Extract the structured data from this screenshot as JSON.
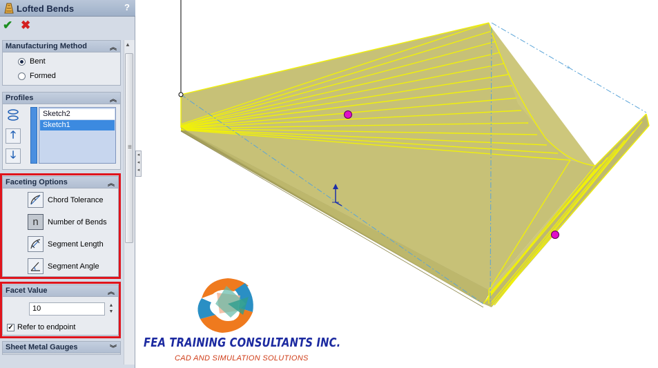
{
  "window": {
    "feature_title": "Lofted Bends",
    "help_glyph": "?",
    "ok_glyph": "✔",
    "cancel_glyph": "✖"
  },
  "manufacturing_method": {
    "title": "Manufacturing Method",
    "options": [
      {
        "label": "Bent",
        "selected": true
      },
      {
        "label": "Formed",
        "selected": false
      }
    ]
  },
  "profiles": {
    "title": "Profiles",
    "items": [
      {
        "label": "Sketch2",
        "selected": false
      },
      {
        "label": "Sketch1",
        "selected": true
      }
    ]
  },
  "faceting_options": {
    "title": "Faceting Options",
    "options": [
      {
        "label": "Chord Tolerance",
        "icon": "chord-tolerance-icon",
        "selected": false
      },
      {
        "label": "Number of Bends",
        "icon": "number-of-bends-icon",
        "icon_glyph": "n",
        "selected": true
      },
      {
        "label": "Segment Length",
        "icon": "segment-length-icon",
        "selected": false
      },
      {
        "label": "Segment Angle",
        "icon": "segment-angle-icon",
        "selected": false
      }
    ]
  },
  "facet_value": {
    "title": "Facet Value",
    "value": "10",
    "refer_to_endpoint_label": "Refer to endpoint",
    "refer_to_endpoint_checked": true
  },
  "sheet_metal_gauges": {
    "title": "Sheet Metal Gauges"
  },
  "logo": {
    "company": "FEA TRAINING  CONSULTANTS INC.",
    "tagline": "CAD AND SIMULATION SOLUTIONS"
  },
  "colors": {
    "model_fill": "#c9c379",
    "model_edge": "#f2f20a",
    "handle": "#e010c8",
    "highlight_frame": "#e0141c"
  }
}
